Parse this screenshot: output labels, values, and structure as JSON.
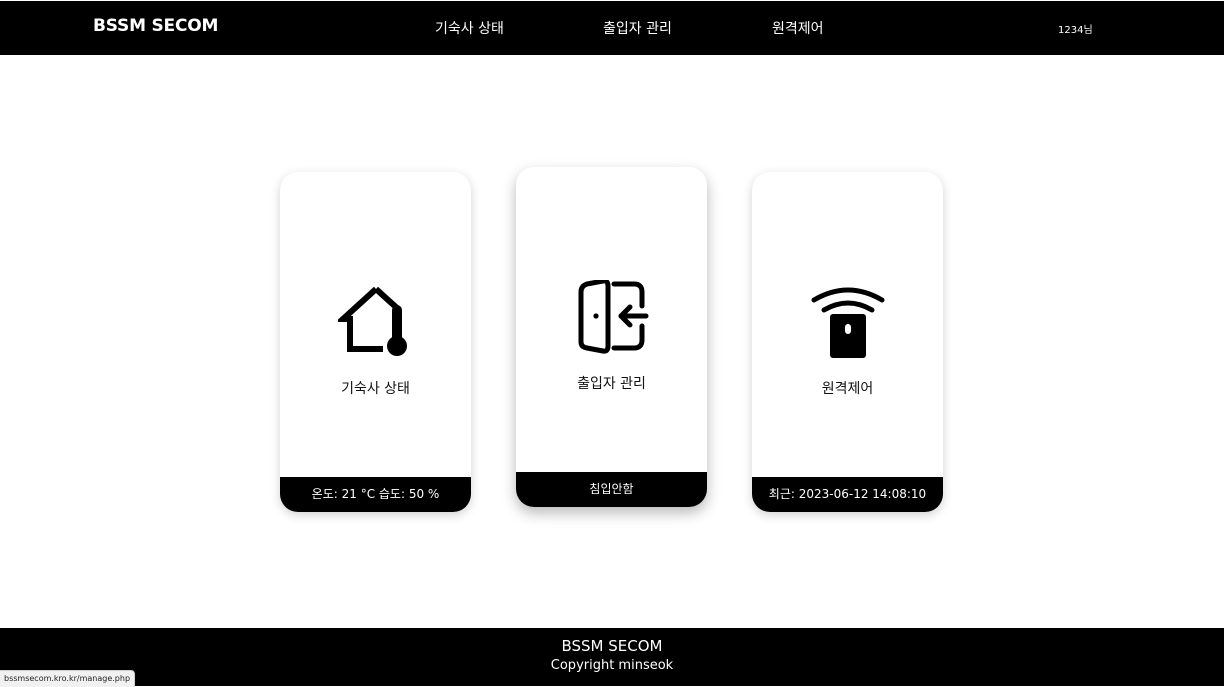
{
  "header": {
    "logo": "BSSM SECOM",
    "nav": [
      "기숙사 상태",
      "출입자 관리",
      "원격제어"
    ],
    "user": "1234님"
  },
  "cards": [
    {
      "icon": "house-thermometer-icon",
      "title": "기숙사 상태",
      "footer": "온도: 21 °C  습도: 50 %"
    },
    {
      "icon": "door-enter-icon",
      "title": "출입자 관리",
      "footer": "침입안함",
      "footer_color": "#1e90ff"
    },
    {
      "icon": "remote-control-icon",
      "title": "원격제어",
      "footer": "최근: 2023-06-12 14:08:10"
    }
  ],
  "footer": {
    "title": "BSSM SECOM",
    "copyright": "Copyright minseok"
  },
  "status_url": "bssmsecom.kro.kr/manage.php"
}
